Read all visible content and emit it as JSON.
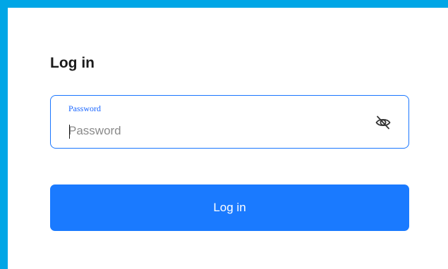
{
  "page": {
    "title": "Log in"
  },
  "password_field": {
    "label": "Password",
    "placeholder": "Password",
    "value": "",
    "toggle_icon": "eye-off-icon"
  },
  "actions": {
    "login_label": "Log in"
  },
  "colors": {
    "frame_border": "#00a6e6",
    "accent": "#1a7aff",
    "field_border": "#1976ff",
    "label": "#1a66ff"
  }
}
